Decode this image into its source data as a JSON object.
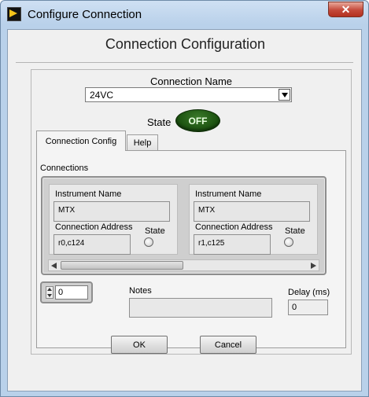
{
  "window": {
    "title": "Configure Connection",
    "close_glyph": "✕"
  },
  "heading": "Connection Configuration",
  "connection_name": {
    "label": "Connection Name",
    "value": "24VC"
  },
  "state": {
    "label": "State",
    "led_text": "OFF",
    "led_on": false
  },
  "tabs": [
    {
      "label": "Connection Config",
      "active": true
    },
    {
      "label": "Help",
      "active": false
    }
  ],
  "connections": {
    "label": "Connections",
    "items": [
      {
        "instrument_name_label": "Instrument Name",
        "instrument_name": "MTX",
        "address_label": "Connection Address",
        "address": "r0,c124",
        "state_label": "State",
        "state_on": false
      },
      {
        "instrument_name_label": "Instrument Name",
        "instrument_name": "MTX",
        "address_label": "Connection Address",
        "address": "r1,c125",
        "state_label": "State",
        "state_on": false
      }
    ]
  },
  "index": {
    "value": "0"
  },
  "notes": {
    "label": "Notes",
    "value": ""
  },
  "delay": {
    "label": "Delay (ms)",
    "value": "0"
  },
  "buttons": {
    "ok": "OK",
    "cancel": "Cancel"
  }
}
